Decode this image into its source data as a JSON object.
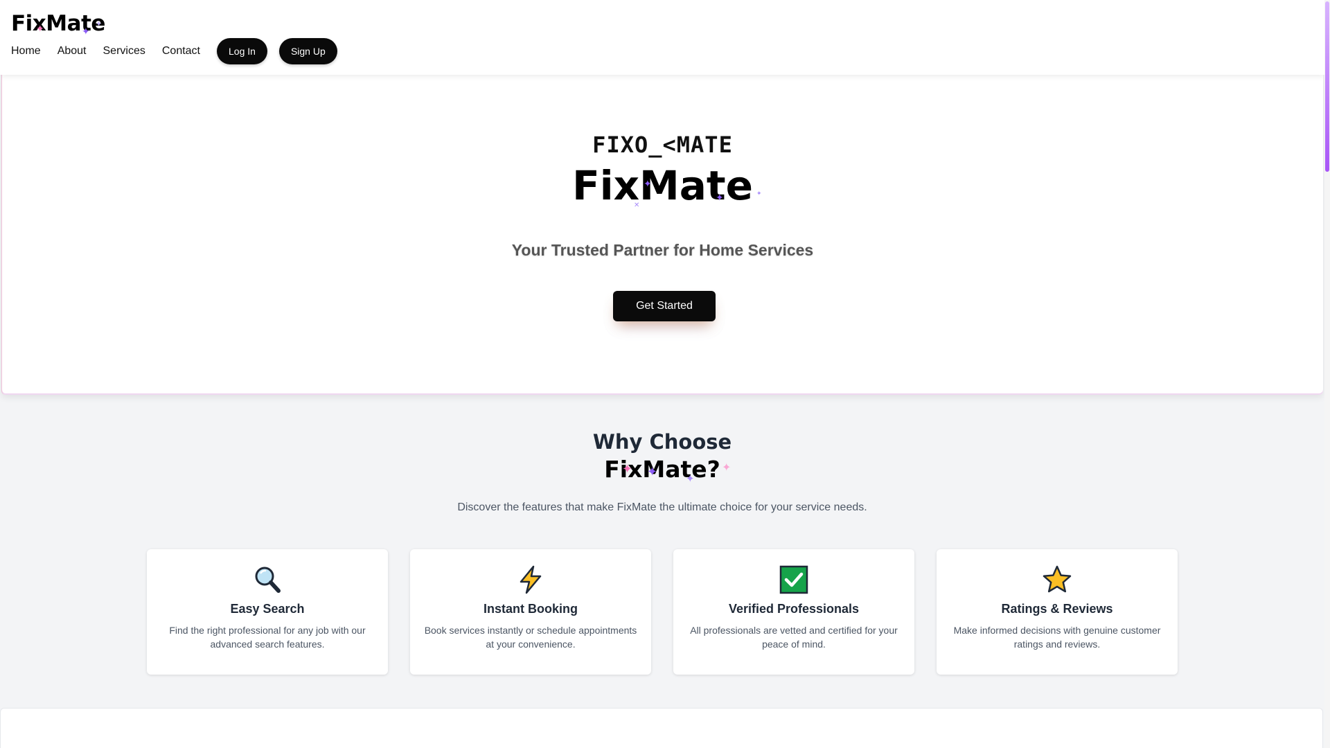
{
  "brand": {
    "logo": "FixMate"
  },
  "nav": {
    "items": [
      "Home",
      "About",
      "Services",
      "Contact"
    ],
    "login": "Log In",
    "signup": "Sign Up"
  },
  "hero": {
    "code_text": "FIXO_<MATE",
    "title": "FixMate",
    "tagline": "Your Trusted Partner for Home Services",
    "cta": "Get Started"
  },
  "why": {
    "title_line1": "Why Choose",
    "title_line2": "FixMate?",
    "subtitle": "Discover the features that make FixMate the ultimate choice for your service needs."
  },
  "features": [
    {
      "icon": "magnifier-icon",
      "title": "Easy Search",
      "desc": "Find the right professional for any job with our advanced search features."
    },
    {
      "icon": "lightning-icon",
      "title": "Instant Booking",
      "desc": "Book services instantly or schedule appointments at your convenience."
    },
    {
      "icon": "check-box-icon",
      "title": "Verified Professionals",
      "desc": "All professionals are vetted and certified for your peace of mind."
    },
    {
      "icon": "star-icon",
      "title": "Ratings & Reviews",
      "desc": "Make informed decisions with genuine customer ratings and reviews."
    }
  ],
  "colors": {
    "primary_button": "#0a0a0a",
    "page_bg": "#f3f4f6",
    "sparkle_pink": "#f472b6",
    "sparkle_purple": "#8b5cf6"
  }
}
